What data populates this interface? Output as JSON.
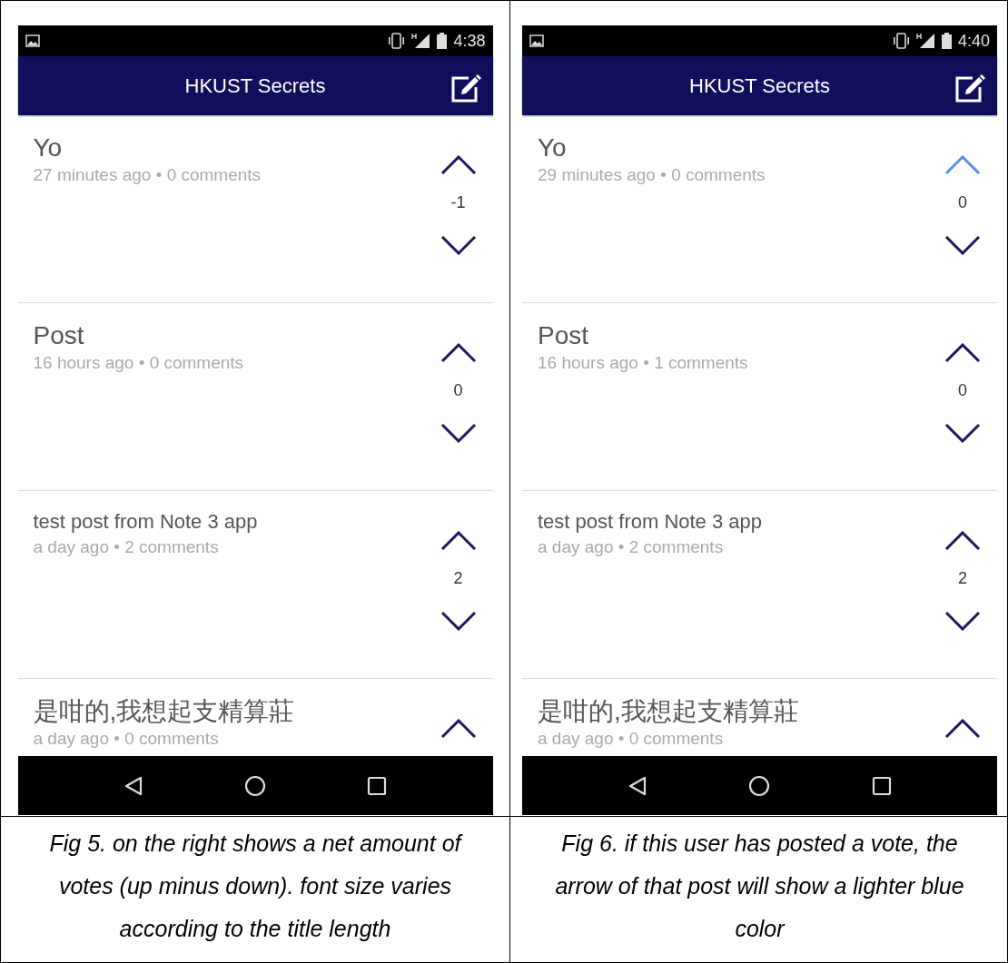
{
  "figures": [
    {
      "status_bar": {
        "time": "4:38"
      },
      "app_bar": {
        "title": "HKUST Secrets"
      },
      "posts": [
        {
          "title": "Yo",
          "kind": "regular",
          "meta": "27 minutes ago • 0 comments",
          "upvoted": false,
          "score": "-1"
        },
        {
          "title": "Post",
          "kind": "regular",
          "meta": "16 hours ago • 0 comments",
          "upvoted": false,
          "score": "0"
        },
        {
          "title": "test post from Note 3 app",
          "kind": "compact",
          "meta": "a day ago • 2 comments",
          "upvoted": false,
          "score": "2"
        },
        {
          "title": "是咁的,我想起支精算莊",
          "kind": "regular",
          "meta": "a day ago • 0 comments",
          "upvoted": false
        }
      ],
      "caption": "Fig 5. on the right shows a net amount of votes (up minus down). font size varies according to the title length"
    },
    {
      "status_bar": {
        "time": "4:40"
      },
      "app_bar": {
        "title": "HKUST Secrets"
      },
      "posts": [
        {
          "title": "Yo",
          "kind": "regular",
          "meta": "29 minutes ago • 0 comments",
          "upvoted": true,
          "score": "0"
        },
        {
          "title": "Post",
          "kind": "regular",
          "meta": "16 hours ago • 1 comments",
          "upvoted": false,
          "score": "0"
        },
        {
          "title": "test post from Note 3 app",
          "kind": "compact",
          "meta": "a day ago • 2 comments",
          "upvoted": false,
          "score": "2"
        },
        {
          "title": "是咁的,我想起支精算莊",
          "kind": "regular",
          "meta": "a day ago • 0 comments",
          "upvoted": false
        }
      ],
      "caption": "Fig 6. if this user has posted a vote, the arrow of that post will show a lighter blue color"
    }
  ]
}
